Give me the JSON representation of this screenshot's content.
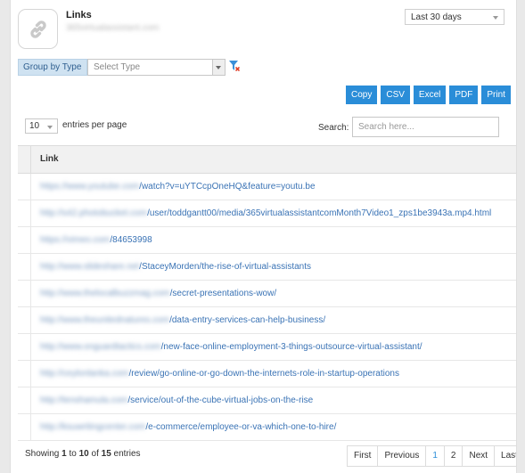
{
  "header": {
    "title": "Links",
    "subtitle": "365virtualassistant.com",
    "range": "Last 30 days"
  },
  "filter": {
    "group_label": "Group by Type",
    "type_placeholder": "Select Type"
  },
  "export_buttons": [
    "Copy",
    "CSV",
    "Excel",
    "PDF",
    "Print"
  ],
  "table_controls": {
    "length_value": "10",
    "length_label": "entries per page",
    "search_label": "Search:",
    "search_placeholder": "Search here..."
  },
  "table": {
    "header": "Link",
    "rows": [
      {
        "prefix": "https://www.youtube.com",
        "rest": "/watch?v=uYTCcpOneHQ&feature=youtu.be"
      },
      {
        "prefix": "http://s42.photobucket.com",
        "rest": "/user/toddgantt00/media/365virtualassistantcomMonth7Video1_zps1be3943a.mp4.html"
      },
      {
        "prefix": "https://vimeo.com",
        "rest": "/84653998"
      },
      {
        "prefix": "http://www.slideshare.net",
        "rest": "/StaceyMorden/the-rise-of-virtual-assistants"
      },
      {
        "prefix": "http://www.thelocalbuzzmag.com",
        "rest": "/secret-presentations-wow/"
      },
      {
        "prefix": "http://www.theunitednatures.com",
        "rest": "/data-entry-services-can-help-business/"
      },
      {
        "prefix": "http://www.onguardtactics.com",
        "rest": "/new-face-online-employment-3-things-outsource-virtual-assistant/"
      },
      {
        "prefix": "http://ceylonlanka.com",
        "rest": "/review/go-online-or-go-down-the-internets-role-in-startup-operations"
      },
      {
        "prefix": "http://tenshamula.com",
        "rest": "/service/out-of-the-cube-virtual-jobs-on-the-rise"
      },
      {
        "prefix": "http://ksuwritingcenter.com",
        "rest": "/e-commerce/employee-or-va-which-one-to-hire/"
      }
    ]
  },
  "footer": {
    "info_prefix": "Showing ",
    "from": "1",
    "to_text": " to ",
    "to": "10",
    "of_text": " of ",
    "total": "15",
    "entries_text": " entries"
  },
  "pagination": [
    "First",
    "Previous",
    "1",
    "2",
    "Next",
    "Last"
  ],
  "colors": {
    "accent": "#2a8dd8",
    "link": "#3a73b5",
    "header_bg": "#f1f1f1"
  }
}
